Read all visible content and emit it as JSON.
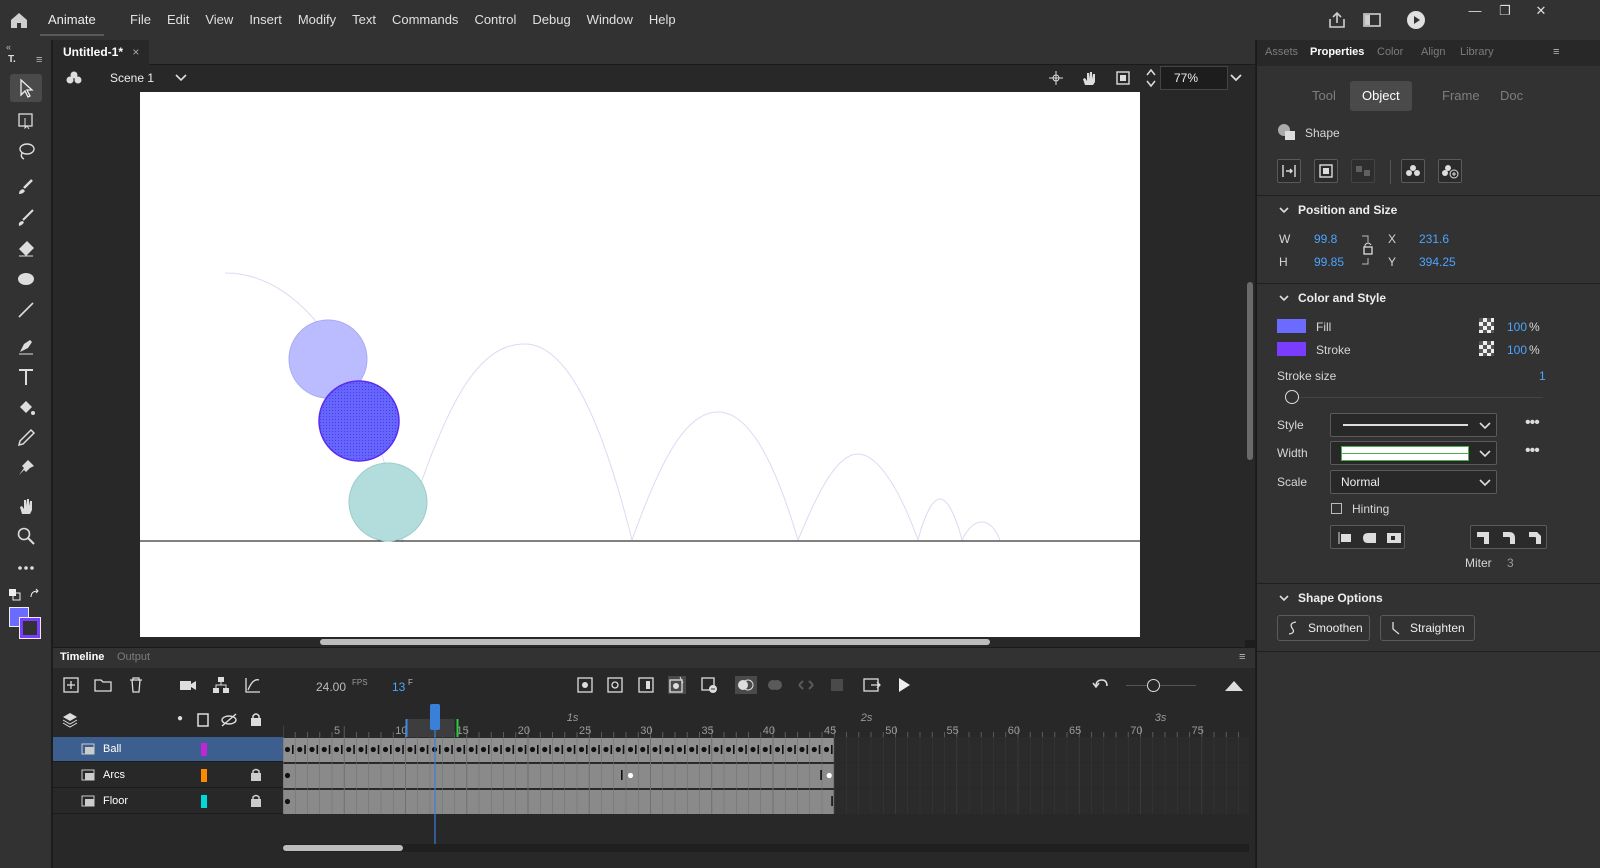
{
  "app": {
    "name": "Animate",
    "menus": [
      "File",
      "Edit",
      "View",
      "Insert",
      "Modify",
      "Text",
      "Commands",
      "Control",
      "Debug",
      "Window",
      "Help"
    ]
  },
  "document": {
    "tab_title": "Untitled-1*",
    "close_glyph": "×",
    "scene": "Scene 1",
    "zoom": "77%"
  },
  "timeline": {
    "tabs": [
      "Timeline",
      "Output"
    ],
    "fps": "24.00",
    "fps_unit": "FPS",
    "current_frame": "13",
    "frame_unit": "F",
    "frame_numbers": [
      "5",
      "10",
      "15",
      "20",
      "25",
      "30",
      "35",
      "40",
      "45",
      "50",
      "55",
      "60",
      "65",
      "70",
      "75"
    ],
    "second_markers": [
      "1s",
      "2s",
      "3s"
    ],
    "layers": [
      {
        "name": "Ball",
        "color": "#c026d3",
        "selected": true,
        "locked": false
      },
      {
        "name": "Arcs",
        "color": "#ff8a00",
        "selected": false,
        "locked": true
      },
      {
        "name": "Floor",
        "color": "#00d9d9",
        "selected": false,
        "locked": true
      }
    ]
  },
  "panel": {
    "tabs": [
      "Assets",
      "Properties",
      "Color",
      "Align",
      "Library"
    ],
    "active_tab": "Properties",
    "subtabs": [
      "Tool",
      "Object",
      "Frame",
      "Doc"
    ],
    "active_subtab": "Object",
    "object_type": "Shape",
    "position_size": {
      "title": "Position and Size",
      "w_label": "W",
      "w": "99.8",
      "h_label": "H",
      "h": "99.85",
      "x_label": "X",
      "x": "231.6",
      "y_label": "Y",
      "y": "394.25"
    },
    "color_style": {
      "title": "Color and Style",
      "fill_label": "Fill",
      "fill_color": "#6b6bff",
      "fill_alpha": "100",
      "stroke_label": "Stroke",
      "stroke_color": "#7a3cff",
      "stroke_alpha": "100",
      "percent": "%",
      "stroke_size_label": "Stroke size",
      "stroke_size": "1",
      "style_label": "Style",
      "width_label": "Width",
      "scale_label": "Scale",
      "scale_value": "Normal",
      "hinting_label": "Hinting",
      "miter_label": "Miter",
      "miter_value": "3"
    },
    "shape_options": {
      "title": "Shape Options",
      "smoothen": "Smoothen",
      "straighten": "Straighten"
    }
  },
  "colors": {
    "ui_bg": "#323232",
    "selection_blue": "#3c5f8f",
    "accent_blue": "#4ca3ff",
    "playhead": "#3a80d8"
  }
}
